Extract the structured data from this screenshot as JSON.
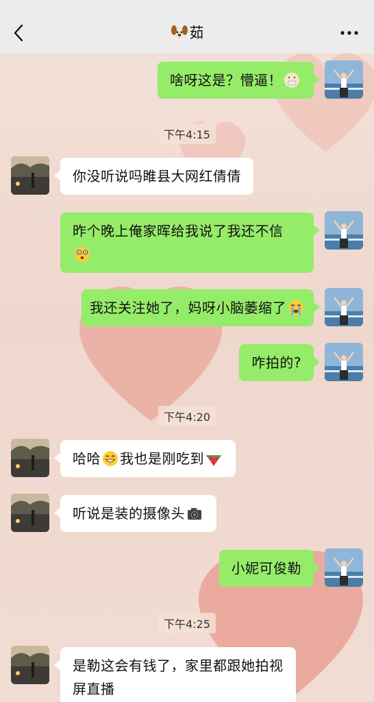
{
  "header": {
    "title": "茹",
    "back_icon": "chevron-left-icon",
    "dog_icon": "dog-face-icon",
    "more_icon": "more-dots-icon"
  },
  "messages": [
    {
      "side": "right",
      "text": "啥呀这是？懵逼！",
      "emoji": "speechless-face-emoji"
    },
    {
      "type": "time",
      "text": "下午4:15"
    },
    {
      "side": "left",
      "text": "你没听说吗睢县大网红倩倩"
    },
    {
      "side": "right",
      "text": "昨个晚上俺家晖给我说了我还不信",
      "emoji": "dizzy-face-emoji"
    },
    {
      "side": "right",
      "text": "我还关注她了，妈呀小脑萎缩了",
      "emoji": "crying-face-emoji"
    },
    {
      "side": "right",
      "text": "咋拍的?"
    },
    {
      "type": "time",
      "text": "下午4:20"
    },
    {
      "side": "left",
      "text_a": "哈哈",
      "emoji_a": "grinning-face-emoji",
      "text_b": "我也是刚吃到",
      "emoji_b": "watermelon-emoji"
    },
    {
      "side": "left",
      "text": "听说是装的摄像头",
      "emoji": "camera-emoji"
    },
    {
      "side": "right",
      "text": "小妮可俊勒"
    },
    {
      "type": "time",
      "text": "下午4:25"
    },
    {
      "side": "left",
      "text_line1": "是勒这会有钱了，家里都跟她拍视",
      "text_line2": "屏直播"
    }
  ],
  "colors": {
    "green_bubble": "#95ec69",
    "white_bubble": "#ffffff",
    "background": "#f1dcd3",
    "header": "#ececec"
  }
}
